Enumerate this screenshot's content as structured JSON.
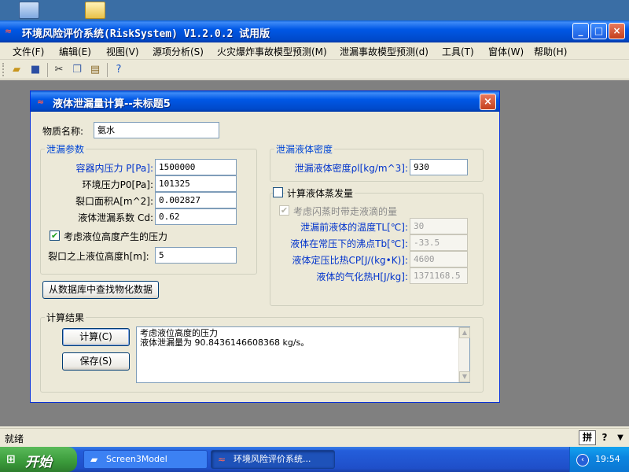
{
  "window": {
    "title": "环境风险评价系统(RiskSystem) V1.2.0.2 试用版",
    "minimize": "_",
    "maximize": "□",
    "close": "×"
  },
  "menu": [
    "文件(F)",
    "编辑(E)",
    "视图(V)",
    "源项分析(S)",
    "火灾爆炸事故模型预测(M)",
    "泄漏事故模型预测(d)",
    "工具(T)",
    "窗体(W)",
    "帮助(H)"
  ],
  "toolbar": {
    "icons": [
      "open-folder-icon",
      "save-icon",
      "cut-icon",
      "copy-icon",
      "paste-icon",
      "help-icon"
    ]
  },
  "status": {
    "text": "就绪",
    "ime": "拼",
    "help": "?"
  },
  "dialog": {
    "title": "液体泄漏量计算--未标题5",
    "close": "×",
    "substance_label": "物质名称:",
    "substance_value": "氨水",
    "leak_params": {
      "title": "泄漏参数",
      "pressure_label": "容器内压力 P[Pa]:",
      "pressure_value": "1500000",
      "ambient_label": "环境压力P0[Pa]:",
      "ambient_value": "101325",
      "area_label": "裂口面积A[m^2]:",
      "area_value": "0.002827",
      "coef_label": "液体泄漏系数  Cd:",
      "coef_value": "0.62",
      "height_check_label": "考虑液位高度产生的压力",
      "height_checked": true,
      "height_label": "裂口之上液位高度h[m]:",
      "height_value": "5"
    },
    "density": {
      "title": "泄漏液体密度",
      "label": "泄漏液体密度ρl[kg/m^3]:",
      "value": "930"
    },
    "evaporation": {
      "title": "计算液体蒸发量",
      "checked": false,
      "flash_label": "考虑闪蒸时带走液滴的量",
      "flash_checked": true,
      "temp_label": "泄漏前液体的温度TL[℃]:",
      "temp_value": "30",
      "boil_label": "液体在常压下的沸点Tb[℃]:",
      "boil_value": "-33.5",
      "cp_label": "液体定压比热CP[J/(kg•K)]:",
      "cp_value": "4600",
      "heat_label": "液体的气化热H[J/kg]:",
      "heat_value": "1371168.5"
    },
    "lookup_button": "从数据库中查找物化数据",
    "results": {
      "title": "计算结果",
      "calc_button": "计算(C)",
      "save_button": "保存(S)",
      "line1": "考虑液位高度的压力",
      "line2": "液体泄漏量为 90.8436146608368 kg/s。"
    }
  },
  "taskbar": {
    "start": "开始",
    "tasks": [
      "Screen3Model",
      "环境风险评价系统..."
    ],
    "clock": "19:54"
  }
}
